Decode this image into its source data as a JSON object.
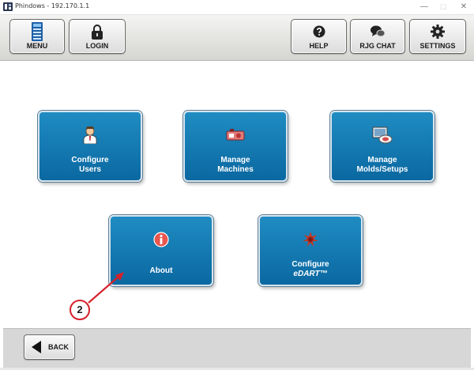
{
  "window": {
    "title": "Phindows - 192.170.1.1",
    "minimize_glyph": "—",
    "maximize_glyph": "☐",
    "close_glyph": "✕"
  },
  "toolbar": {
    "menu_label": "MENU",
    "login_label": "LOGIN",
    "help_label": "HELP",
    "chat_label": "RJG CHAT",
    "settings_label": "SETTINGS",
    "icons": {
      "menu": "menu-icon",
      "login": "lock-icon",
      "help": "help-icon",
      "chat": "chat-icon",
      "settings": "gear-icon"
    }
  },
  "tiles": [
    {
      "line1": "Configure",
      "line2": "Users",
      "icon": "users-icon"
    },
    {
      "line1": "Manage",
      "line2": "Machines",
      "icon": "machine-icon"
    },
    {
      "line1": "Manage",
      "line2": "Molds/Setups",
      "icon": "mold-icon"
    },
    {
      "line1": "About",
      "icon": "info-icon"
    },
    {
      "line1": "Configure",
      "line2": "eDART™",
      "icon": "edart-icon"
    }
  ],
  "annotation": {
    "step_number": "2",
    "color": "#d6202a"
  },
  "footer": {
    "back_label": "BACK",
    "back_icon": "back-arrow-icon"
  },
  "colors": {
    "tile_blue": "#0b68a1",
    "toolbar_gray": "#d5d6d2",
    "footer_gray": "#d7d7d7"
  }
}
